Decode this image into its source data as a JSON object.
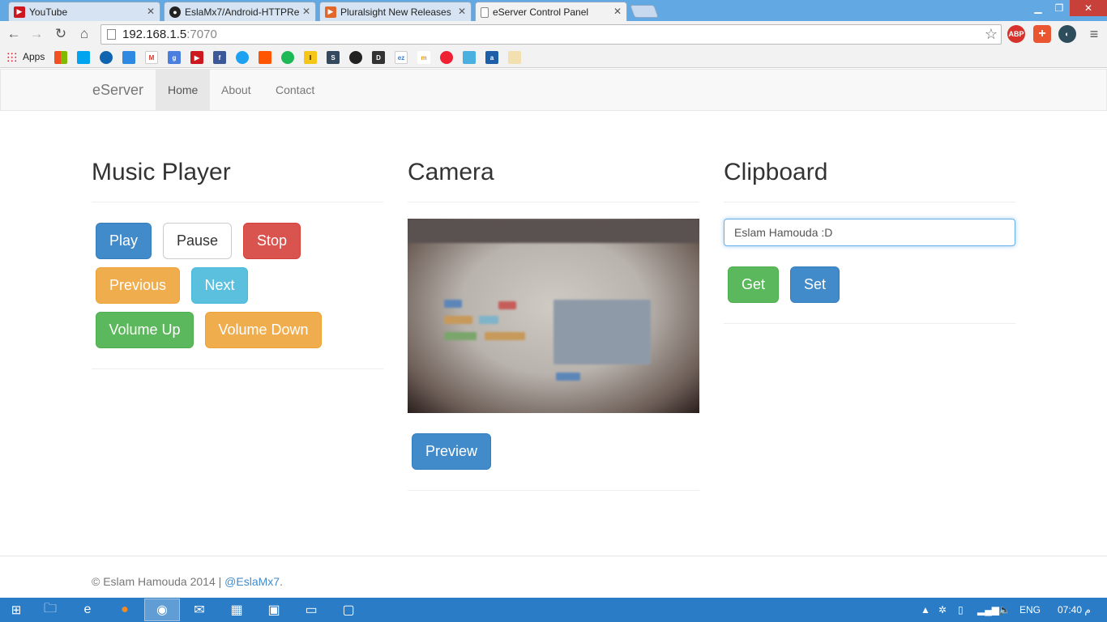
{
  "browser": {
    "tabs": [
      {
        "label": "YouTube",
        "icon": "youtube-icon"
      },
      {
        "label": "EslaMx7/Android-HTTPRe",
        "icon": "github-icon"
      },
      {
        "label": "Pluralsight New Releases",
        "icon": "pluralsight-icon"
      },
      {
        "label": "eServer Control Panel",
        "icon": "document-icon"
      }
    ],
    "address": {
      "host": "192.168.1.5",
      "port": ":7070"
    },
    "bookmarks_apps_label": "Apps",
    "extensions": [
      "ABP"
    ]
  },
  "navbar": {
    "brand": "eServer",
    "links": [
      "Home",
      "About",
      "Contact"
    ],
    "active": "Home"
  },
  "music_player": {
    "title": "Music Player",
    "buttons": {
      "play": "Play",
      "pause": "Pause",
      "stop": "Stop",
      "previous": "Previous",
      "next": "Next",
      "volume_up": "Volume Up",
      "volume_down": "Volume Down"
    }
  },
  "camera": {
    "title": "Camera",
    "preview_label": "Preview"
  },
  "clipboard": {
    "title": "Clipboard",
    "value": "Eslam Hamouda :D",
    "get_label": "Get",
    "set_label": "Set"
  },
  "footer": {
    "text": "© Eslam Hamouda 2014 | ",
    "link": "@EslaMx7",
    "suffix": "."
  },
  "taskbar": {
    "language": "ENG",
    "time": "07:40",
    "ampm": "م"
  },
  "colors": {
    "primary": "#428bca",
    "danger": "#d9534f",
    "warning": "#f0ad4e",
    "info": "#5bc0de",
    "success": "#5cb85c",
    "taskbar": "#2b7cc7",
    "titlebar": "#62a8e3"
  }
}
